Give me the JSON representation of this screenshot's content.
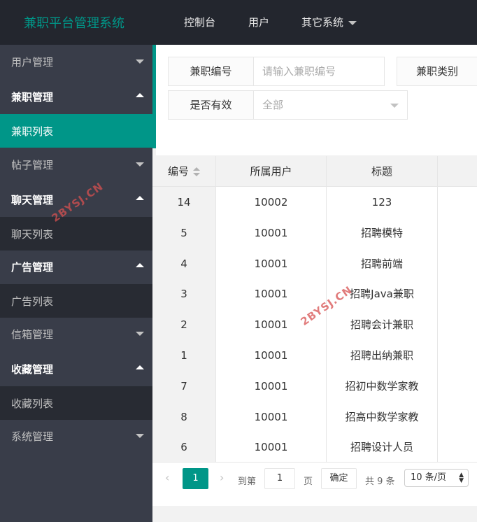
{
  "header": {
    "brand": "兼职平台管理系统",
    "nav": [
      "控制台",
      "用户",
      "其它系统"
    ]
  },
  "sidebar": {
    "items": [
      {
        "label": "用户管理",
        "type": "parent",
        "icon": "chevron-down-icon"
      },
      {
        "label": "兼职管理",
        "type": "parent-open",
        "icon": "chevron-up-icon"
      },
      {
        "label": "兼职列表",
        "type": "child-active"
      },
      {
        "label": "帖子管理",
        "type": "parent",
        "icon": "chevron-down-icon"
      },
      {
        "label": "聊天管理",
        "type": "parent-open",
        "icon": "chevron-up-icon"
      },
      {
        "label": "聊天列表",
        "type": "child"
      },
      {
        "label": "广告管理",
        "type": "parent-open",
        "icon": "chevron-up-icon"
      },
      {
        "label": "广告列表",
        "type": "child"
      },
      {
        "label": "信箱管理",
        "type": "parent",
        "icon": "chevron-down-icon"
      },
      {
        "label": "收藏管理",
        "type": "parent-open",
        "icon": "chevron-up-icon"
      },
      {
        "label": "收藏列表",
        "type": "child"
      },
      {
        "label": "系统管理",
        "type": "parent",
        "icon": "chevron-down-icon"
      }
    ]
  },
  "filters": {
    "id_label": "兼职编号",
    "id_placeholder": "请输入兼职编号",
    "category_label": "兼职类别",
    "valid_label": "是否有效",
    "valid_value": "全部"
  },
  "table": {
    "headers": [
      "编号",
      "所属用户",
      "标题"
    ],
    "rows": [
      [
        "14",
        "10002",
        "123"
      ],
      [
        "5",
        "10001",
        "招聘模特"
      ],
      [
        "4",
        "10001",
        "招聘前端"
      ],
      [
        "3",
        "10001",
        "招聘Java兼职"
      ],
      [
        "2",
        "10001",
        "招聘会计兼职"
      ],
      [
        "1",
        "10001",
        "招聘出纳兼职"
      ],
      [
        "7",
        "10001",
        "招初中数学家教"
      ],
      [
        "8",
        "10001",
        "招高中数学家教"
      ],
      [
        "6",
        "10001",
        "招聘设计人员"
      ]
    ]
  },
  "pagination": {
    "prev": "‹",
    "current": "1",
    "next": "›",
    "goto_label": "到第",
    "goto_value": "1",
    "page_unit": "页",
    "confirm": "确定",
    "total": "共 9 条",
    "page_size": "10 条/页"
  },
  "watermark": "2BYSJ.CN",
  "colors": {
    "accent": "#009688",
    "topbar": "#23262e",
    "sidebar": "#393d49",
    "sidebar_child": "#282b33"
  }
}
